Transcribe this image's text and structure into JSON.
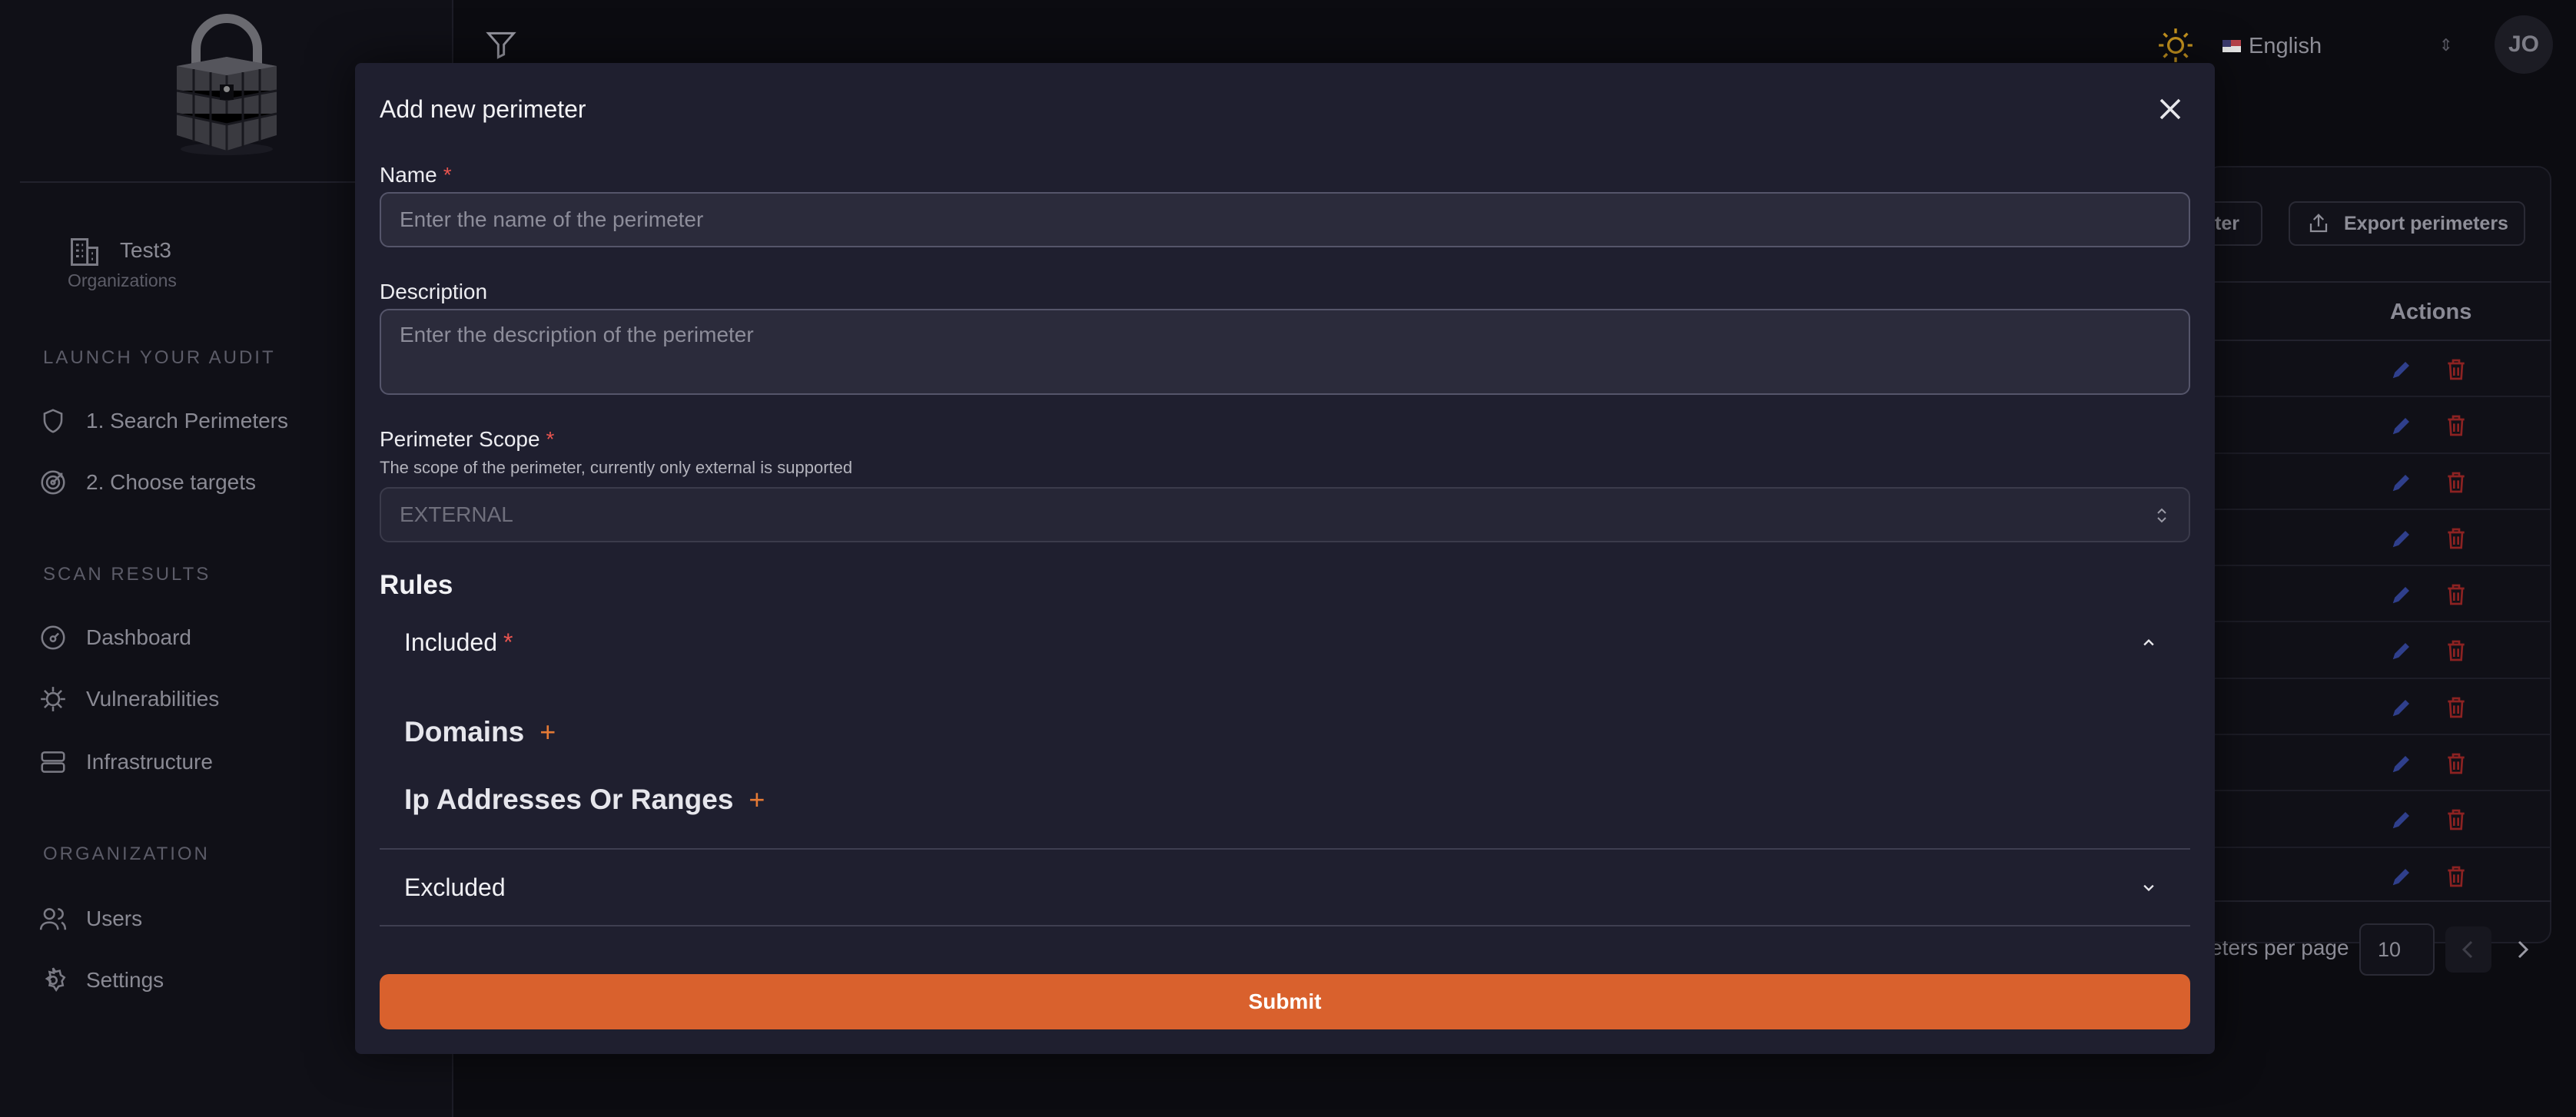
{
  "sidebar": {
    "organization": {
      "name": "Test3",
      "subtitle": "Organizations"
    },
    "sections": {
      "launch": "LAUNCH YOUR AUDIT",
      "scan": "SCAN RESULTS",
      "organization": "ORGANIZATION"
    },
    "items": {
      "search_perimeters": "1. Search Perimeters",
      "choose_targets": "2. Choose targets",
      "dashboard": "Dashboard",
      "vulnerabilities": "Vulnerabilities",
      "infrastructure": "Infrastructure",
      "users": "Users",
      "settings": "Settings"
    }
  },
  "topbar": {
    "language": "English",
    "avatar_initials": "JO"
  },
  "background_page": {
    "new_button_partial": "eter",
    "export_button": "Export perimeters",
    "actions_header": "Actions",
    "row_count": 10,
    "rows_per_page_label": "eters per page",
    "rows_per_page_value": "10"
  },
  "modal": {
    "title": "Add new perimeter",
    "name": {
      "label": "Name",
      "required": "*",
      "placeholder": "Enter the name of the perimeter"
    },
    "description": {
      "label": "Description",
      "placeholder": "Enter the description of the perimeter"
    },
    "scope": {
      "label": "Perimeter Scope",
      "required": "*",
      "hint": "The scope of the perimeter, currently only external is supported",
      "value": "EXTERNAL"
    },
    "rules": {
      "title": "Rules",
      "included": {
        "label": "Included",
        "required": "*",
        "expanded": true
      },
      "domains": "Domains",
      "ip_ranges": "Ip Addresses Or Ranges",
      "plus": "+",
      "excluded": {
        "label": "Excluded",
        "expanded": false
      }
    },
    "submit": "Submit"
  },
  "colors": {
    "accent": "#d9612d",
    "plus": "#e47a35",
    "required": "#e8544f",
    "modal_bg": "#1f1f2f",
    "page_bg": "#0c0c11",
    "edit_icon": "#2f3f8c",
    "delete_icon": "#8c2222"
  },
  "icons": {
    "logo": "padlock-cube-logo",
    "filter": "filter-icon",
    "theme": "sun-icon",
    "close": "close-icon",
    "edit": "pencil-icon",
    "delete": "trash-icon"
  }
}
